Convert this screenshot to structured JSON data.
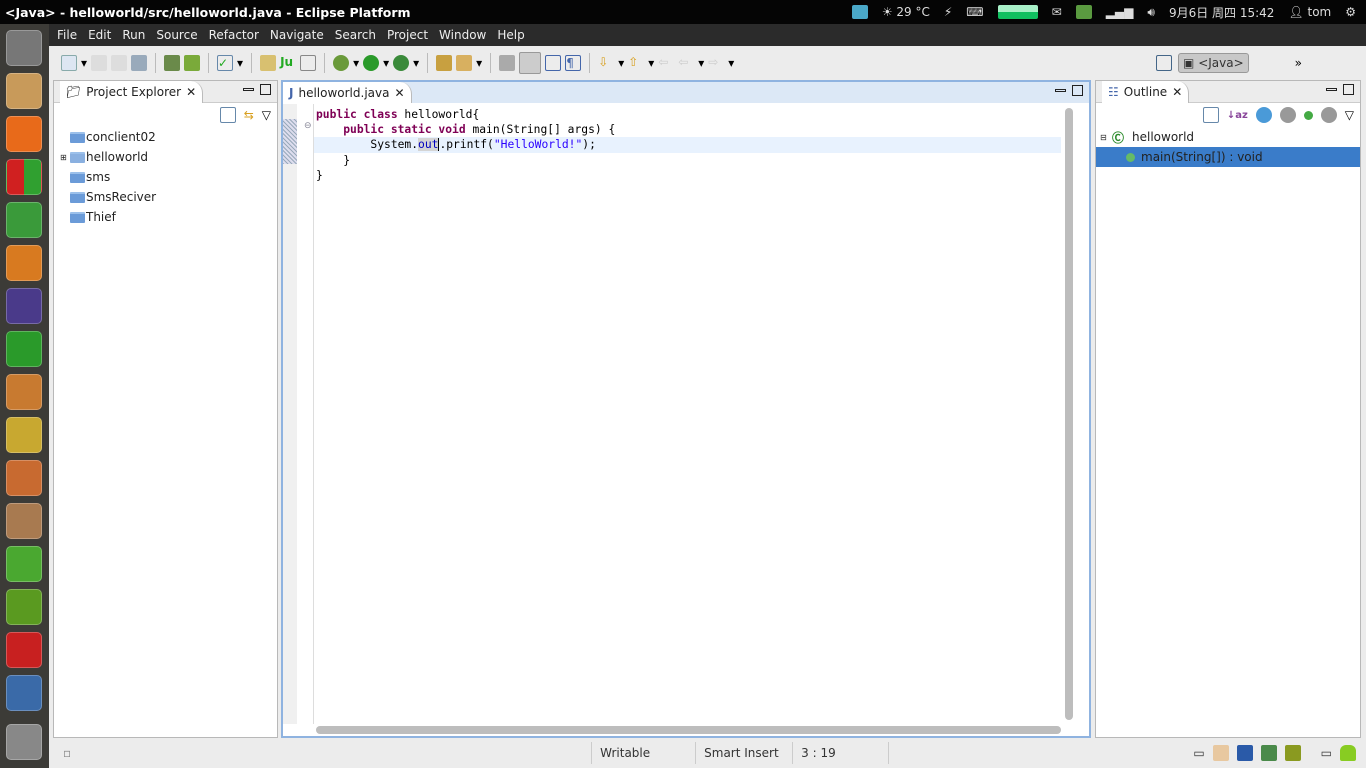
{
  "window": {
    "title": "<Java> - helloworld/src/helloworld.java - Eclipse Platform"
  },
  "indicators": {
    "weather": "29 °C",
    "datetime": "9月6日 周四 15:42",
    "user": "tom"
  },
  "launcher": {
    "items": [
      "ubuntu-dash",
      "files",
      "network",
      "windows-app",
      "chrome",
      "firefox",
      "eclipse",
      "vim",
      "wps",
      "editor",
      "paint",
      "archive",
      "mypaint",
      "synaptic",
      "acrobat",
      "workspace",
      "trash"
    ]
  },
  "menu": [
    "File",
    "Edit",
    "Run",
    "Source",
    "Refactor",
    "Navigate",
    "Search",
    "Project",
    "Window",
    "Help"
  ],
  "perspective": {
    "label": "<Java>"
  },
  "project_explorer": {
    "title": "Project Explorer",
    "items": [
      {
        "label": "conclient02"
      },
      {
        "label": "helloworld",
        "expandable": true,
        "open": true
      },
      {
        "label": "sms"
      },
      {
        "label": "SmsReciver"
      },
      {
        "label": "Thief"
      }
    ]
  },
  "editor": {
    "tab": "helloworld.java",
    "lines": {
      "l1a": "public class",
      "l1b": " helloworld{",
      "l2a": "public static void",
      "l2b": " main(String[] args) {",
      "l3a": "System.",
      "l3b": "out",
      "l3c": ".printf(",
      "l3d": "\"HelloWorld!\"",
      "l3e": ");",
      "l4": "}",
      "l5": "}"
    }
  },
  "outline": {
    "title": "Outline",
    "class": "helloworld",
    "method": "main(String[]) : void"
  },
  "status": {
    "mode": "Writable",
    "insert": "Smart Insert",
    "position": "3 : 19"
  },
  "colors": {
    "keyword": "#7f0055",
    "field": "#0000c0",
    "string": "#2a00ff",
    "selection": "#3a7cc9"
  }
}
